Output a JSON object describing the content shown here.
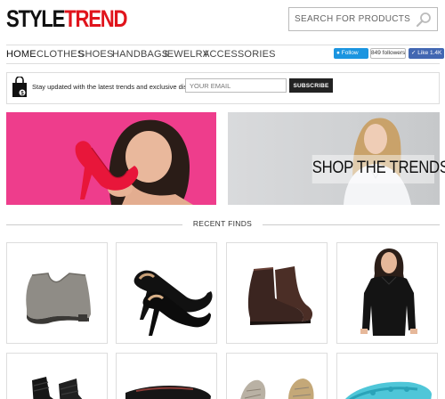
{
  "logo": {
    "part1": "STYLE",
    "part2": "TREND"
  },
  "search": {
    "placeholder": "SEARCH FOR PRODUCTS",
    "value": ""
  },
  "nav": {
    "items": [
      "HOME",
      "CLOTHES",
      "SHOES",
      "HANDBAGS",
      "JEWELRY",
      "ACCESSORIES"
    ],
    "active": "HOME"
  },
  "social": {
    "twitter_label": "Follow",
    "twitter_count": "849 followers",
    "facebook_label": "Like 1.4K"
  },
  "newsletter": {
    "text": "Stay updated with the latest trends and exclusive discounts!",
    "email_placeholder": "YOUR EMAIL",
    "button_label": "SUBSCRIBE"
  },
  "banners": {
    "right_label": "SHOP THE TRENDS"
  },
  "section": {
    "title": "RECENT FINDS"
  },
  "colors": {
    "brand_red": "#e0141c",
    "banner_pink": "#ee3d8c",
    "twitter_blue": "#1b95e0",
    "facebook_blue": "#4267b2"
  },
  "products": [
    {
      "name": "grey-ankle-bootie"
    },
    {
      "name": "black-patent-peep-toe-pump"
    },
    {
      "name": "brown-leather-chelsea-boot"
    },
    {
      "name": "black-knit-top"
    },
    {
      "name": "black-slouch-boot"
    },
    {
      "name": "black-pointed-flat"
    },
    {
      "name": "metallic-snake-flat"
    },
    {
      "name": "turquoise-sandal"
    }
  ]
}
